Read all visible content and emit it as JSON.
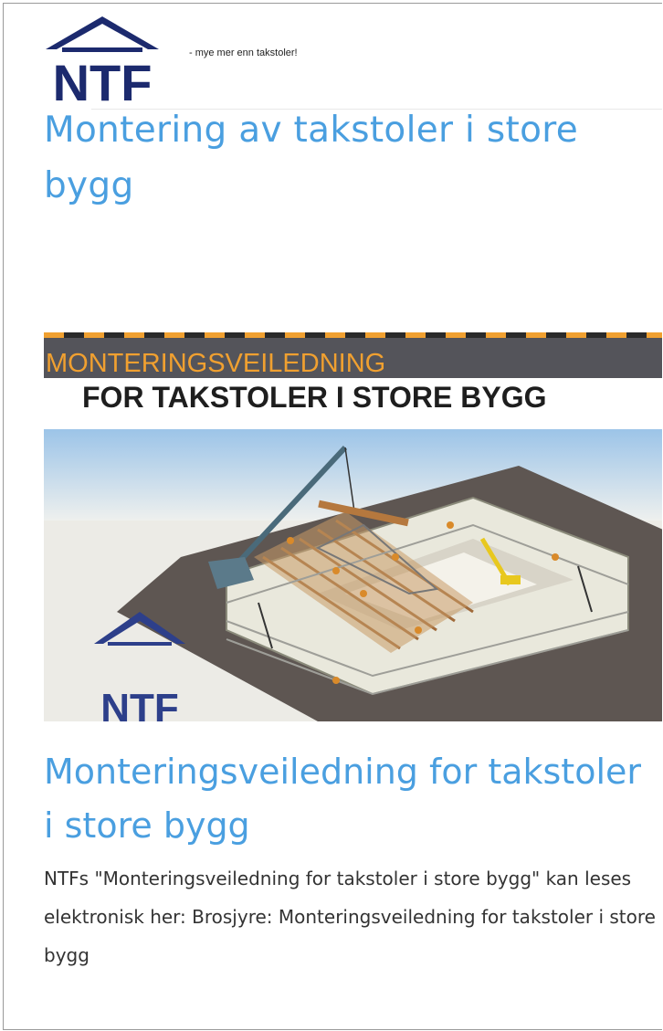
{
  "header": {
    "logo_text": "NTF",
    "tagline": "- mye mer enn takstoler!"
  },
  "page": {
    "title": "Montering av takstoler i store bygg"
  },
  "hero": {
    "line1": "MONTERINGSVEILEDNING",
    "line2": "FOR TAKSTOLER I STORE BYGG",
    "logo_text": "NTF"
  },
  "article": {
    "title": "Monteringsveiledning for takstoler i store bygg",
    "body": "NTFs \"Monteringsveiledning for takstoler i store bygg\" kan leses elektronisk her: Brosjyre: Monteringsveiledning for takstoler i store bygg"
  },
  "colors": {
    "brand_navy": "#1c2a6e",
    "heading_blue": "#4a9fe0",
    "accent_orange": "#f0a030"
  }
}
